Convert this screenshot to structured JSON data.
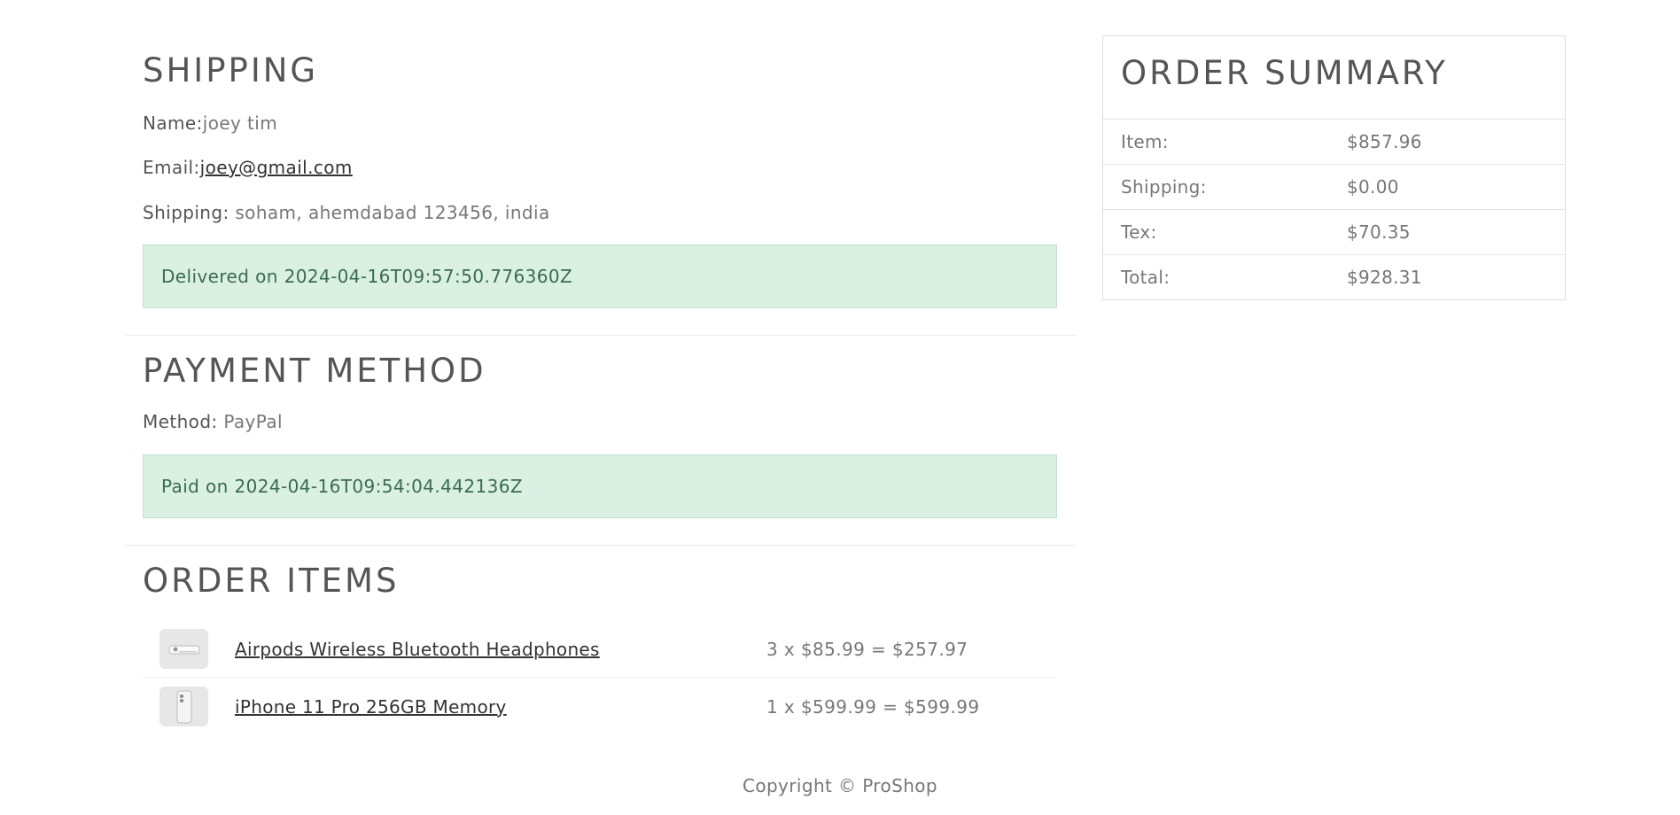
{
  "shipping": {
    "heading": "SHIPPING",
    "name_label": "Name:",
    "name_value": "joey tim",
    "email_label": "Email:",
    "email_value": "joey@gmail.com",
    "address_label": "Shipping:",
    "address_value": "soham, ahemdabad 123456, india",
    "status": "Delivered on 2024-04-16T09:57:50.776360Z"
  },
  "payment": {
    "heading": "PAYMENT METHOD",
    "method_label": "Method:",
    "method_value": "PayPal",
    "status": "Paid on 2024-04-16T09:54:04.442136Z"
  },
  "order_items": {
    "heading": "ORDER ITEMS",
    "items": [
      {
        "name": "Airpods Wireless Bluetooth Headphones",
        "price_line": "3 x $85.99 = $257.97",
        "icon": "airpods-image"
      },
      {
        "name": "iPhone 11 Pro 256GB Memory",
        "price_line": "1 x $599.99 = $599.99",
        "icon": "iphone-image"
      }
    ]
  },
  "summary": {
    "heading": "ORDER SUMMARY",
    "rows": [
      {
        "label": "Item:",
        "value": "$857.96"
      },
      {
        "label": "Shipping:",
        "value": "$0.00"
      },
      {
        "label": "Tex:",
        "value": "$70.35"
      },
      {
        "label": "Total:",
        "value": "$928.31"
      }
    ]
  },
  "footer": {
    "text": "Copyright © ProShop"
  },
  "colors": {
    "success_bg": "#d9f0e2",
    "success_text": "#3c6b4f",
    "heading": "#555555"
  }
}
